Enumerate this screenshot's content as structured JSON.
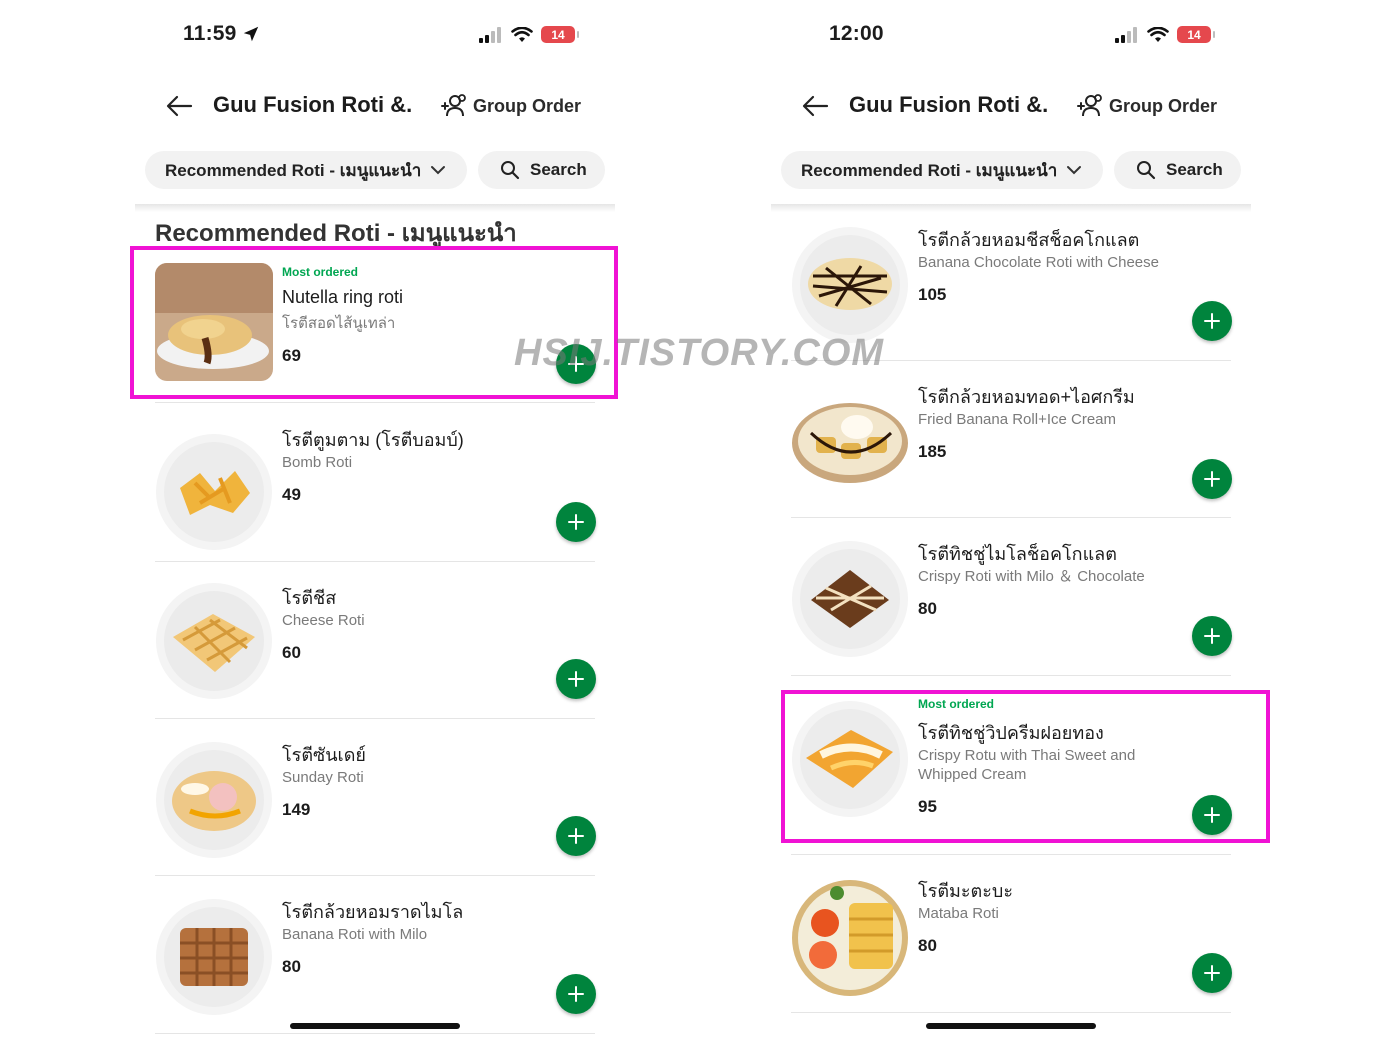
{
  "colors": {
    "brand_green": "#00843d",
    "badge_green": "#00a651",
    "highlight_magenta": "#f012d4",
    "battery_red": "#e5484d"
  },
  "left": {
    "status": {
      "time": "11:59",
      "battery": "14",
      "location_icon": "location-arrow-icon"
    },
    "header": {
      "back_icon": "back-arrow-icon",
      "title": "Guu Fusion Roti &...",
      "group_order_icon": "group-order-icon",
      "group_order": "Group Order"
    },
    "filter": {
      "category": "Recommended Roti - เมนูแนะนำ",
      "search": "Search"
    },
    "section_title": "Recommended Roti - เมนูแนะนำ",
    "items": [
      {
        "badge": "Most ordered",
        "name": "Nutella ring roti",
        "subname": "โรตีสอดไส้นูเทล่า",
        "price": "69"
      },
      {
        "badge": "",
        "name": "โรตีตูมตาม (โรตีบอมบ์)",
        "subname": "Bomb Roti",
        "price": "49"
      },
      {
        "badge": "",
        "name": "โรตีชีส",
        "subname": "Cheese Roti",
        "price": "60"
      },
      {
        "badge": "",
        "name": "โรตีซันเดย์",
        "subname": "Sunday Roti",
        "price": "149"
      },
      {
        "badge": "",
        "name": "โรตีกล้วยหอมราดไมโล",
        "subname": "Banana Roti with Milo",
        "price": "80"
      }
    ]
  },
  "right": {
    "status": {
      "time": "12:00",
      "battery": "14"
    },
    "header": {
      "back_icon": "back-arrow-icon",
      "title": "Guu Fusion Roti &...",
      "group_order_icon": "group-order-icon",
      "group_order": "Group Order"
    },
    "filter": {
      "category": "Recommended Roti - เมนูแนะนำ",
      "search": "Search"
    },
    "items": [
      {
        "badge": "",
        "name": "โรตีกล้วยหอมชีสช็อคโกแลต",
        "subname": "Banana Chocolate Roti with Cheese",
        "price": "105"
      },
      {
        "badge": "",
        "name": "โรตีกล้วยหอมทอด+ไอศกรีม",
        "subname": "Fried Banana Roll+Ice Cream",
        "price": "185"
      },
      {
        "badge": "",
        "name": "โรตีทิชชู่ไมโลช็อคโกแลต",
        "subname": "Crispy Roti with Milo ＆ Chocolate",
        "price": "80"
      },
      {
        "badge": "Most ordered",
        "name": "โรตีทิชชู่วิปครีมฝอยทอง",
        "subname": "Crispy Rotu with Thai Sweet and Whipped Cream",
        "price": "95"
      },
      {
        "badge": "",
        "name": "โรตีมะตะบะ",
        "subname": "Mataba Roti",
        "price": "80"
      }
    ]
  },
  "watermark": "HSIJ.TISTORY.COM"
}
